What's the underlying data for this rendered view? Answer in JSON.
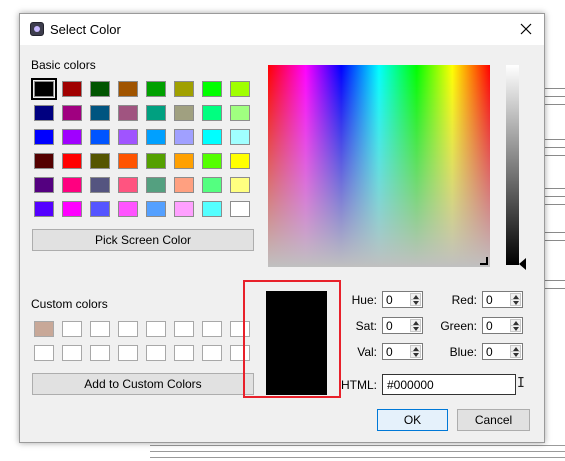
{
  "window": {
    "title": "Select Color",
    "close_icon": "close-icon"
  },
  "basic": {
    "label": "Basic colors",
    "selected_index": 0,
    "rows": [
      [
        "#000000",
        "#a00000",
        "#005400",
        "#a05400",
        "#00a000",
        "#a0a000",
        "#00ff00",
        "#a0ff00"
      ],
      [
        "#000080",
        "#a00080",
        "#005480",
        "#a05480",
        "#00a080",
        "#a0a080",
        "#00ff80",
        "#a0ff80"
      ],
      [
        "#0000ff",
        "#a000ff",
        "#0054ff",
        "#a054ff",
        "#00a0ff",
        "#a0a0ff",
        "#00ffff",
        "#a0ffff"
      ],
      [
        "#540000",
        "#ff0000",
        "#545400",
        "#ff5400",
        "#54a000",
        "#ffa000",
        "#54ff00",
        "#ffff00"
      ],
      [
        "#540080",
        "#ff0080",
        "#545480",
        "#ff5480",
        "#54a080",
        "#ffa080",
        "#54ff80",
        "#ffff80"
      ],
      [
        "#5400ff",
        "#ff00ff",
        "#5454ff",
        "#ff54ff",
        "#54a0ff",
        "#ffa0ff",
        "#54ffff",
        "#ffffff"
      ]
    ]
  },
  "pick_screen_label": "Pick Screen Color",
  "custom": {
    "label": "Custom colors",
    "slots": [
      "#c8a898",
      "#ffffff",
      "#ffffff",
      "#ffffff",
      "#ffffff",
      "#ffffff",
      "#ffffff",
      "#ffffff",
      "#ffffff",
      "#ffffff",
      "#ffffff",
      "#ffffff",
      "#ffffff",
      "#ffffff",
      "#ffffff",
      "#ffffff"
    ]
  },
  "add_custom_label": "Add to Custom Colors",
  "current_color": "#000000",
  "highlight_color": "#e8202a",
  "fields": {
    "hue": {
      "label": "Hue:",
      "value": "0"
    },
    "sat": {
      "label": "Sat:",
      "value": "0"
    },
    "val": {
      "label": "Val:",
      "value": "0"
    },
    "red": {
      "label": "Red:",
      "value": "0"
    },
    "green": {
      "label": "Green:",
      "value": "0"
    },
    "blue": {
      "label": "Blue:",
      "value": "0"
    }
  },
  "html": {
    "label": "HTML:",
    "value": "#000000"
  },
  "buttons": {
    "ok": "OK",
    "cancel": "Cancel"
  }
}
